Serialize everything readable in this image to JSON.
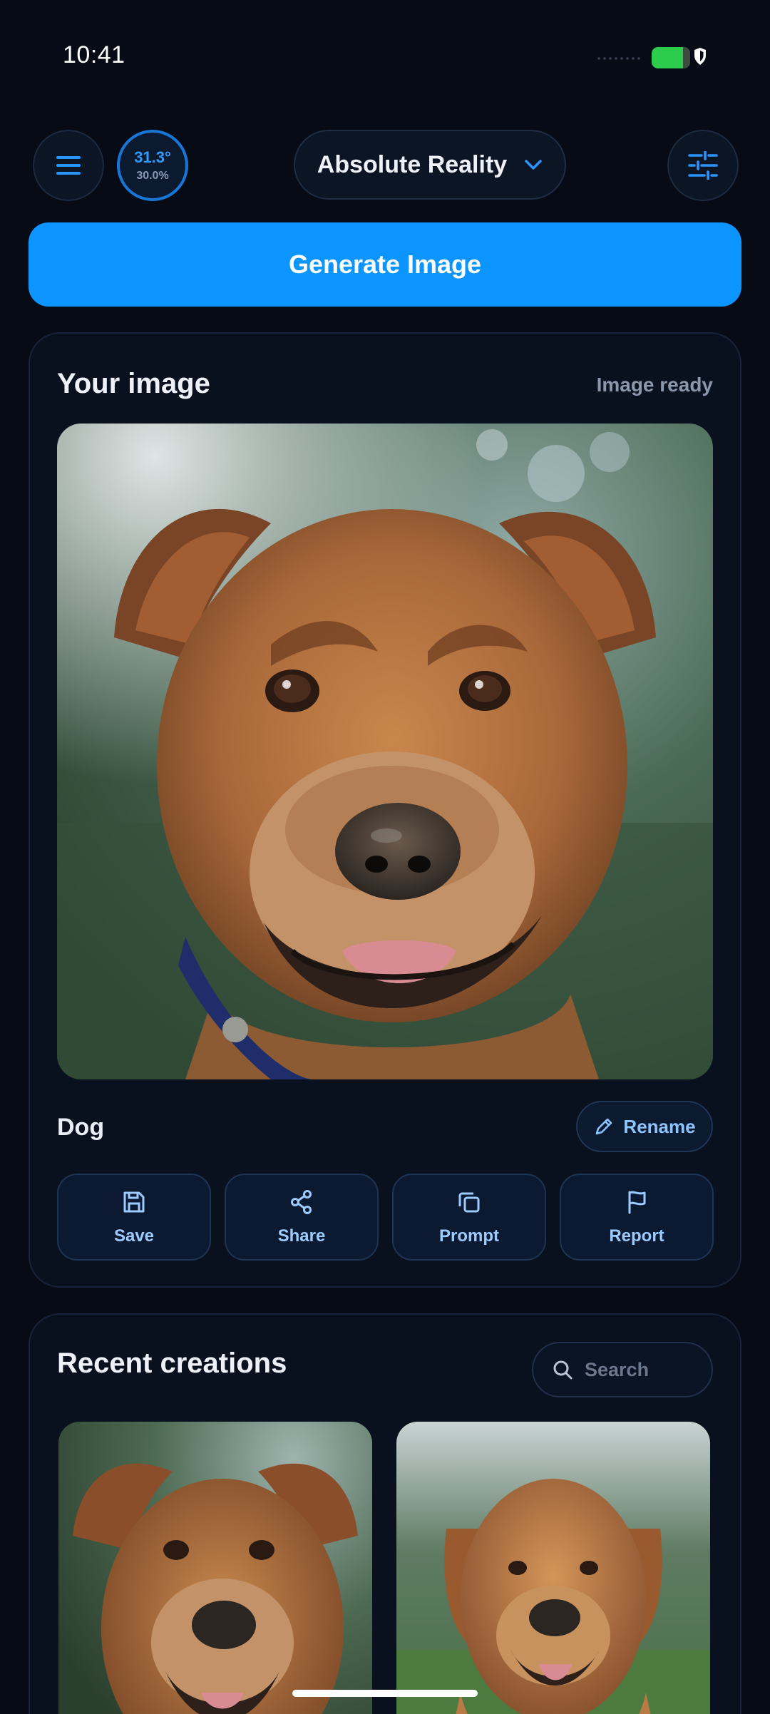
{
  "status_bar": {
    "time": "10:41"
  },
  "header": {
    "menu_icon": "hamburger-menu-icon",
    "temperature": {
      "primary": "31.3°",
      "secondary": "30.0%"
    },
    "model_selector": {
      "label": "Absolute Reality",
      "icon": "chevron-down-icon"
    },
    "filter_icon": "sliders-icon"
  },
  "generate": {
    "label": "Generate Image"
  },
  "image_card": {
    "title": "Your image",
    "status": "Image ready",
    "image_name": "Dog",
    "rename_label": "Rename",
    "actions": [
      {
        "label": "Save",
        "icon": "floppy-disk-icon"
      },
      {
        "label": "Share",
        "icon": "share-nodes-icon"
      },
      {
        "label": "Prompt",
        "icon": "copy-icon"
      },
      {
        "label": "Report",
        "icon": "flag-icon"
      }
    ]
  },
  "recent": {
    "title": "Recent creations",
    "search_placeholder": "Search"
  },
  "colors": {
    "background": "#060b16",
    "accent": "#0d95ff",
    "card": "#0a111e",
    "action_text": "#9ccbff"
  }
}
